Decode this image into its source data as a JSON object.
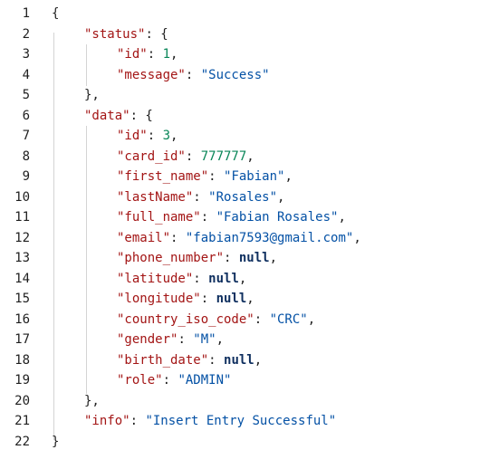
{
  "lines": [
    {
      "n": "1",
      "indent": 0,
      "tokens": [
        {
          "t": "punc",
          "v": "{"
        }
      ]
    },
    {
      "n": "2",
      "indent": 1,
      "tokens": [
        {
          "t": "key",
          "v": "\"status\""
        },
        {
          "t": "punc",
          "v": ": {"
        }
      ]
    },
    {
      "n": "3",
      "indent": 2,
      "tokens": [
        {
          "t": "key",
          "v": "\"id\""
        },
        {
          "t": "punc",
          "v": ": "
        },
        {
          "t": "num",
          "v": "1"
        },
        {
          "t": "punc",
          "v": ","
        }
      ]
    },
    {
      "n": "4",
      "indent": 2,
      "tokens": [
        {
          "t": "key",
          "v": "\"message\""
        },
        {
          "t": "punc",
          "v": ": "
        },
        {
          "t": "str",
          "v": "\"Success\""
        }
      ]
    },
    {
      "n": "5",
      "indent": 1,
      "tokens": [
        {
          "t": "punc",
          "v": "},"
        }
      ]
    },
    {
      "n": "6",
      "indent": 1,
      "tokens": [
        {
          "t": "key",
          "v": "\"data\""
        },
        {
          "t": "punc",
          "v": ": {"
        }
      ]
    },
    {
      "n": "7",
      "indent": 2,
      "tokens": [
        {
          "t": "key",
          "v": "\"id\""
        },
        {
          "t": "punc",
          "v": ": "
        },
        {
          "t": "num",
          "v": "3"
        },
        {
          "t": "punc",
          "v": ","
        }
      ]
    },
    {
      "n": "8",
      "indent": 2,
      "tokens": [
        {
          "t": "key",
          "v": "\"card_id\""
        },
        {
          "t": "punc",
          "v": ": "
        },
        {
          "t": "num",
          "v": "777777"
        },
        {
          "t": "punc",
          "v": ","
        }
      ]
    },
    {
      "n": "9",
      "indent": 2,
      "tokens": [
        {
          "t": "key",
          "v": "\"first_name\""
        },
        {
          "t": "punc",
          "v": ": "
        },
        {
          "t": "str",
          "v": "\"Fabian\""
        },
        {
          "t": "punc",
          "v": ","
        }
      ]
    },
    {
      "n": "10",
      "indent": 2,
      "tokens": [
        {
          "t": "key",
          "v": "\"lastName\""
        },
        {
          "t": "punc",
          "v": ": "
        },
        {
          "t": "str",
          "v": "\"Rosales\""
        },
        {
          "t": "punc",
          "v": ","
        }
      ]
    },
    {
      "n": "11",
      "indent": 2,
      "tokens": [
        {
          "t": "key",
          "v": "\"full_name\""
        },
        {
          "t": "punc",
          "v": ": "
        },
        {
          "t": "str",
          "v": "\"Fabian Rosales\""
        },
        {
          "t": "punc",
          "v": ","
        }
      ]
    },
    {
      "n": "12",
      "indent": 2,
      "tokens": [
        {
          "t": "key",
          "v": "\"email\""
        },
        {
          "t": "punc",
          "v": ": "
        },
        {
          "t": "str",
          "v": "\"fabian7593@gmail.com\""
        },
        {
          "t": "punc",
          "v": ","
        }
      ]
    },
    {
      "n": "13",
      "indent": 2,
      "tokens": [
        {
          "t": "key",
          "v": "\"phone_number\""
        },
        {
          "t": "punc",
          "v": ": "
        },
        {
          "t": "lit",
          "v": "null"
        },
        {
          "t": "punc",
          "v": ","
        }
      ]
    },
    {
      "n": "14",
      "indent": 2,
      "tokens": [
        {
          "t": "key",
          "v": "\"latitude\""
        },
        {
          "t": "punc",
          "v": ": "
        },
        {
          "t": "lit",
          "v": "null"
        },
        {
          "t": "punc",
          "v": ","
        }
      ]
    },
    {
      "n": "15",
      "indent": 2,
      "tokens": [
        {
          "t": "key",
          "v": "\"longitude\""
        },
        {
          "t": "punc",
          "v": ": "
        },
        {
          "t": "lit",
          "v": "null"
        },
        {
          "t": "punc",
          "v": ","
        }
      ]
    },
    {
      "n": "16",
      "indent": 2,
      "tokens": [
        {
          "t": "key",
          "v": "\"country_iso_code\""
        },
        {
          "t": "punc",
          "v": ": "
        },
        {
          "t": "str",
          "v": "\"CRC\""
        },
        {
          "t": "punc",
          "v": ","
        }
      ]
    },
    {
      "n": "17",
      "indent": 2,
      "tokens": [
        {
          "t": "key",
          "v": "\"gender\""
        },
        {
          "t": "punc",
          "v": ": "
        },
        {
          "t": "str",
          "v": "\"M\""
        },
        {
          "t": "punc",
          "v": ","
        }
      ]
    },
    {
      "n": "18",
      "indent": 2,
      "tokens": [
        {
          "t": "key",
          "v": "\"birth_date\""
        },
        {
          "t": "punc",
          "v": ": "
        },
        {
          "t": "lit",
          "v": "null"
        },
        {
          "t": "punc",
          "v": ","
        }
      ]
    },
    {
      "n": "19",
      "indent": 2,
      "tokens": [
        {
          "t": "key",
          "v": "\"role\""
        },
        {
          "t": "punc",
          "v": ": "
        },
        {
          "t": "str",
          "v": "\"ADMIN\""
        }
      ]
    },
    {
      "n": "20",
      "indent": 1,
      "tokens": [
        {
          "t": "punc",
          "v": "},"
        }
      ]
    },
    {
      "n": "21",
      "indent": 1,
      "tokens": [
        {
          "t": "key",
          "v": "\"info\""
        },
        {
          "t": "punc",
          "v": ": "
        },
        {
          "t": "str",
          "v": "\"Insert Entry Successful\""
        }
      ]
    },
    {
      "n": "22",
      "indent": 0,
      "tokens": [
        {
          "t": "punc",
          "v": "}"
        }
      ]
    }
  ],
  "colors": {
    "key": "#a31515",
    "string": "#0451a5",
    "number": "#098658",
    "literal": "#0f2f5f",
    "gutter": "#1f1f1f"
  }
}
